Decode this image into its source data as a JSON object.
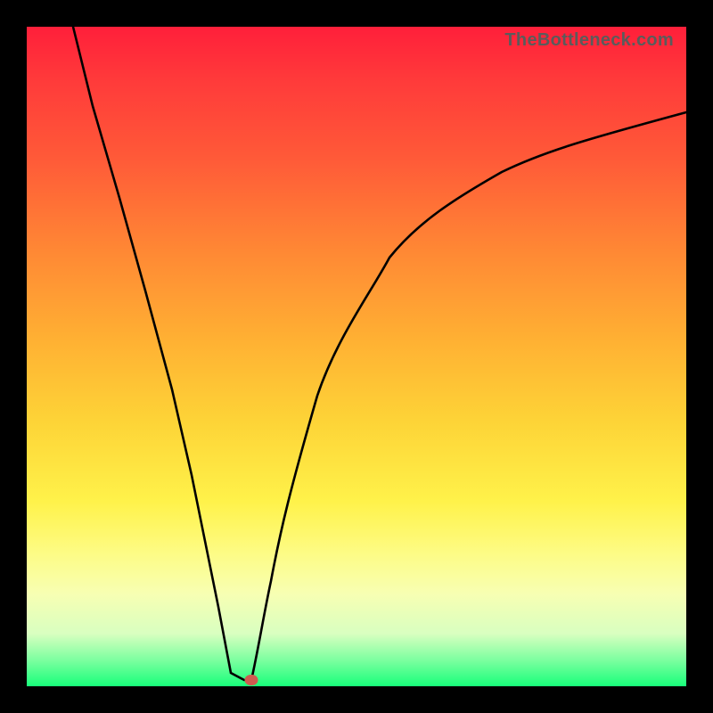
{
  "watermark": "TheBottleneck.com",
  "colors": {
    "curve_stroke": "#000000",
    "marker_fill": "#cf5b50"
  },
  "chart_data": {
    "type": "line",
    "title": "",
    "xlabel": "",
    "ylabel": "",
    "xlim": [
      0,
      100
    ],
    "ylim": [
      0,
      100
    ],
    "grid": false,
    "series": [
      {
        "name": "curve-left",
        "x": [
          7,
          10,
          14,
          18,
          22,
          25,
          27,
          29,
          30,
          31,
          33
        ],
        "y": [
          100,
          88,
          74,
          60,
          45,
          32,
          22,
          12,
          7,
          2,
          1
        ]
      },
      {
        "name": "curve-right",
        "x": [
          34,
          35,
          37,
          40,
          44,
          49,
          55,
          62,
          72,
          85,
          100
        ],
        "y": [
          1,
          5,
          16,
          30,
          44,
          56,
          65,
          72,
          78,
          83,
          87
        ]
      }
    ],
    "annotations": [
      {
        "name": "minimum-marker",
        "x": 34,
        "y": 1
      }
    ]
  }
}
